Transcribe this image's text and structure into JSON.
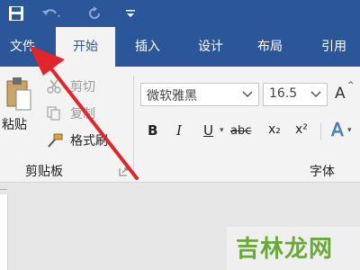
{
  "quick_access": {
    "save_icon": "save-icon",
    "undo_icon": "undo-icon",
    "redo_icon": "redo-icon",
    "customize_icon": "customize-dropdown-icon"
  },
  "tabs": [
    {
      "label": "文件"
    },
    {
      "label": "开始"
    },
    {
      "label": "插入"
    },
    {
      "label": "设计"
    },
    {
      "label": "布局"
    },
    {
      "label": "引用"
    }
  ],
  "clipboard": {
    "paste_label": "粘贴",
    "cut_label": "剪切",
    "copy_label": "复制",
    "format_painter_label": "格式刷",
    "group_label": "剪贴板"
  },
  "font": {
    "font_name": "微软雅黑",
    "font_size": "16.5",
    "grow_label": "A",
    "bold_label": "B",
    "italic_label": "I",
    "underline_label": "U",
    "strike_label": "abc",
    "subscript_label": "x₂",
    "superscript_label": "x²",
    "effects_label": "A",
    "group_label": "字体"
  },
  "watermark": {
    "text": "吉林龙网"
  },
  "colors": {
    "ribbon_blue": "#2b579a",
    "arrow_red": "#e0262b",
    "watermark_green": "#6aa83a"
  }
}
